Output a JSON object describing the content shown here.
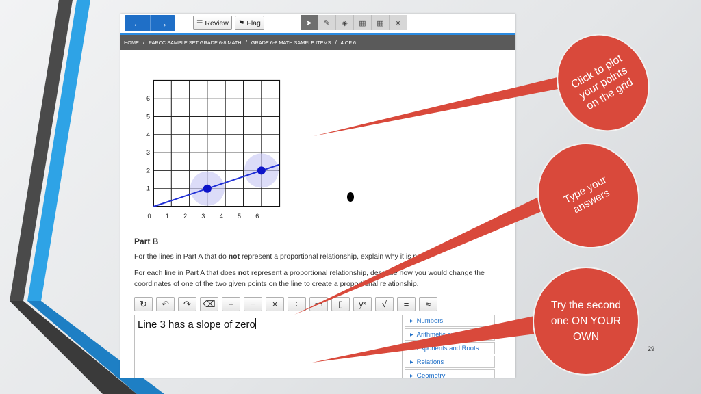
{
  "toolbar": {
    "review_label": "Review",
    "flag_label": "Flag",
    "tools": [
      "pointer-tool",
      "pencil-tool",
      "eraser-tool",
      "table-tool",
      "calculator-tool",
      "close-tool"
    ]
  },
  "breadcrumb": {
    "items": [
      "HOME",
      "PARCC SAMPLE SET GRADE 6-8 MATH",
      "GRADE 6-8 MATH SAMPLE ITEMS",
      "4 OF 6"
    ],
    "separator": "/"
  },
  "graph": {
    "x_ticks": [
      "0",
      "1",
      "2",
      "3",
      "4",
      "5",
      "6"
    ],
    "y_ticks": [
      "1",
      "2",
      "3",
      "4",
      "5",
      "6"
    ],
    "points": [
      {
        "x": 3,
        "y": 1
      },
      {
        "x": 6,
        "y": 2
      }
    ],
    "line_color": "#1f2fd6"
  },
  "part_b": {
    "title": "Part B",
    "q1_pre": "For the lines in Part A that do ",
    "q1_bold": "not",
    "q1_post": " represent a proportional relationship, explain why it is not.",
    "q2_pre": "For each line in Part A that does ",
    "q2_bold": "not",
    "q2_post": " represent a proportional relationship, describe how you would change the coordinates of one of the two given points on the line to create a proportional relationship."
  },
  "equation_toolbar": [
    "↻",
    "↶",
    "↷",
    "⌫",
    "+",
    "−",
    "×",
    "÷",
    "▭",
    "▯",
    "yˣ",
    "√",
    "=",
    "≈"
  ],
  "answer": {
    "text": "Line 3 has a slope of zero"
  },
  "side_panel": [
    "Numbers",
    "Arithmetic and Operators",
    "Exponents and Roots",
    "Relations",
    "Geometry"
  ],
  "callouts": {
    "plot": "Click to plot your points on the grid",
    "type": "Type your answers",
    "try": "Try the second one ON YOUR OWN"
  },
  "colors": {
    "callout": "#d9493b",
    "accent_blue": "#1f6fc7",
    "crumb_bg": "#5a5a5a"
  },
  "page_number": "29"
}
